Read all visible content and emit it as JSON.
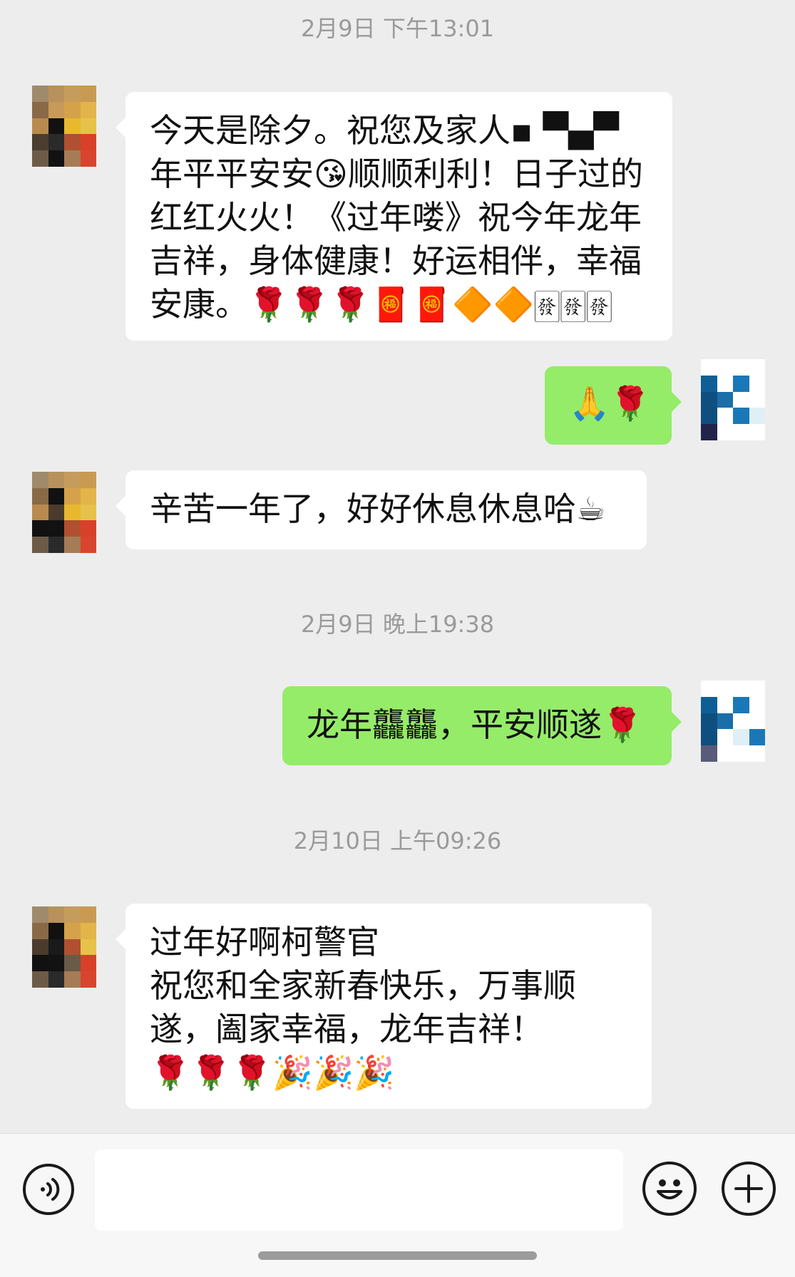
{
  "colors": {
    "chat_background": "#ededed",
    "incoming_bubble": "#ffffff",
    "outgoing_bubble": "#95ec69",
    "timestamp_text": "#9a9a9a",
    "input_bar": "#f7f7f7"
  },
  "timestamps": [
    "2月9日 下午13:01",
    "2月9日 晚上19:38",
    "2月10日 上午09:26"
  ],
  "messages": [
    {
      "direction": "incoming",
      "text": "今天是除夕。祝您及家人▪ ▀▄▀ 年平平安安😘顺顺利利！日子过的红红火火！《过年喽》祝今年龙年吉祥，身体健康！好运相伴，幸福安康。🌹🌹🌹🧧🧧🔶🔶🀅🀅🀅"
    },
    {
      "direction": "outgoing",
      "text": "🙏🌹"
    },
    {
      "direction": "incoming",
      "text": "辛苦一年了，好好休息休息哈☕"
    },
    {
      "direction": "outgoing",
      "text": "龙年龘龘，平安顺遂🌹"
    },
    {
      "direction": "incoming",
      "text": "过年好啊柯警官\n祝您和全家新春快乐，万事顺遂，阖家幸福，龙年吉祥！\n🌹🌹🌹🎉🎉🎉"
    }
  ],
  "input_bar": {
    "voice_icon": "voice-icon",
    "emoji_icon": "emoji-icon",
    "plus_icon": "plus-icon",
    "input_value": ""
  }
}
